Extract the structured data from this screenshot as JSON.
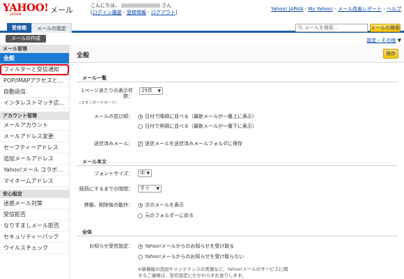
{
  "header": {
    "logo_text": "YAHOO!",
    "logo_sub": "JAPAN",
    "app_name": "メール",
    "greeting_prefix": "こんにちは、",
    "greeting_suffix": "さん",
    "account_links": [
      "ログイン履歴",
      "登録情報",
      "ログアウト"
    ],
    "top_links": [
      "Yahoo! JAPAN",
      "My Yahoo!",
      "メール改善レポート",
      "ヘルプ"
    ]
  },
  "tabs": {
    "inbox": "受信箱",
    "settings": "メールの設定"
  },
  "search": {
    "placeholder": "メールを検索...",
    "button": "メールの検索"
  },
  "compose_label": "メールの作成",
  "settings_link": {
    "label": "設定・その他",
    "arrow": "▼"
  },
  "sidebar": {
    "sections": [
      {
        "title": "メール管理",
        "items": [
          "全般",
          "フィルターと受信通知",
          "POP/IMAPアクセスと…",
          "自動返信",
          "インタレストマッチ広…"
        ]
      },
      {
        "title": "アカウント管理",
        "items": [
          "メールアカウント",
          "メールアドレス変更",
          "セーフティーアドレス",
          "追加メールアドレス",
          "Yahoo!メール コラボ…",
          "マイネームアドレス"
        ]
      },
      {
        "title": "安心設定",
        "items": [
          "迷惑メール対策",
          "受信拒否",
          "なりすましメール拒否",
          "セキュリティーパック",
          "ウイルスチェック"
        ]
      }
    ],
    "selected": "全般",
    "highlighted": "フィルターと受信通知"
  },
  "main": {
    "title": "全般",
    "save": "保存",
    "mail_list": {
      "heading": "メール一覧",
      "per_page_label_1": "1ページあたりの表示件",
      "per_page_label_2": "数：",
      "per_page_sub": "(スタンダードモード)",
      "per_page_value": "25件",
      "sort_label": "メールの並び順：",
      "sort_options": [
        "日付で降順に並べる（最新メールが一番上に表示）",
        "日付で昇順に並べる（最新メールが一番下に表示）"
      ],
      "sort_selected_index": 0,
      "sent_label": "送信済みメール：",
      "sent_option": "送信メールを送信済みメールフォルダに保存",
      "sent_checked": true
    },
    "mail_body": {
      "heading": "メール本文",
      "font_size_label": "フォントサイズ：",
      "font_size_value": "中",
      "read_time_label": "既読にするまでの時間：",
      "read_time_value": "すぐ",
      "after_action_label": "移動、削除後の動作：",
      "after_action_options": [
        "次のメールを表示",
        "元のフォルダーに戻る"
      ],
      "after_action_selected_index": 0
    },
    "general": {
      "heading": "全体",
      "notice_label": "お知らせ受信設定：",
      "notice_options": [
        "Yahoo!メールからのお知らせを受け取る",
        "Yahoo!メールからのお知らせを受け取らない"
      ],
      "notice_selected_index": 0,
      "note_line1": "※新機能の追加やメンテナンスの実施など、Yahoo!メールのサービスに関",
      "note_line2": "するご連絡は、受信設定にかかわらずお送りします。"
    }
  },
  "colors": {
    "brand_red": "#d00000",
    "tab_blue": "#1a5ea6",
    "selected_blue": "#1a7ad6",
    "highlight_red": "#e3001b",
    "button_yellow": "#f2c300"
  }
}
